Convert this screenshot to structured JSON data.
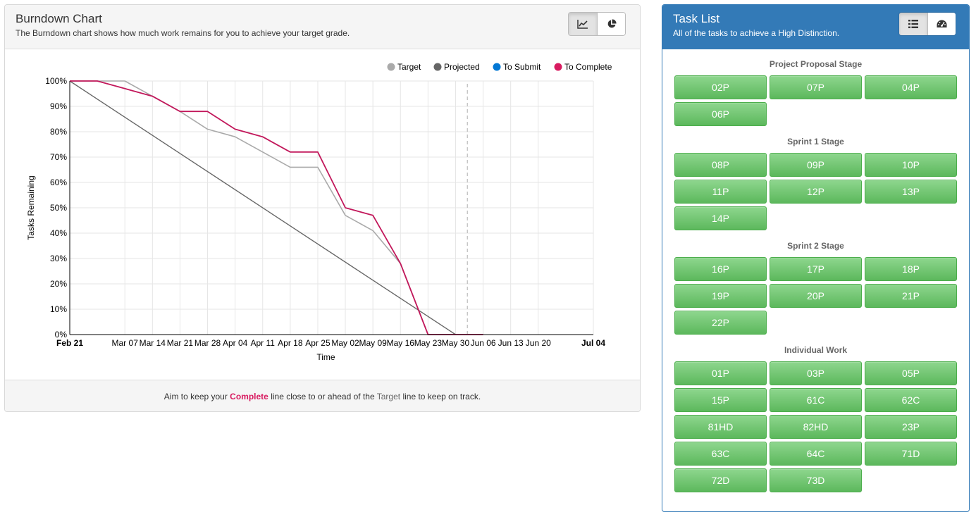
{
  "burndown": {
    "title": "Burndown Chart",
    "subtitle": "The Burndown chart shows how much work remains for you to achieve your target grade.",
    "view_buttons": [
      {
        "icon": "line-chart-icon",
        "active": true
      },
      {
        "icon": "pie-chart-icon",
        "active": false
      }
    ],
    "footer": {
      "prefix": "Aim to keep your ",
      "complete_word": "Complete",
      "middle": " line close to or ahead of the ",
      "target_word": "Target",
      "suffix": " line to keep on track."
    }
  },
  "chart_data": {
    "type": "line",
    "xlabel": "Time",
    "ylabel": "Tasks Remaining",
    "ylim": [
      0,
      100
    ],
    "y_ticks": [
      "0%",
      "10%",
      "20%",
      "30%",
      "40%",
      "50%",
      "60%",
      "70%",
      "80%",
      "90%",
      "100%"
    ],
    "x_ticks": [
      "Feb 21",
      "Mar 07",
      "Mar 14",
      "Mar 21",
      "Mar 28",
      "Apr 04",
      "Apr 11",
      "Apr 18",
      "Apr 25",
      "May 02",
      "May 09",
      "May 16",
      "May 23",
      "May 30",
      "Jun 06",
      "Jun 13",
      "Jun 20",
      "Jul 04"
    ],
    "x_bold_ticks": [
      "Feb 21",
      "Jul 04"
    ],
    "x_tick_days": [
      0,
      14,
      21,
      28,
      35,
      42,
      49,
      56,
      63,
      70,
      77,
      84,
      91,
      98,
      105,
      112,
      119,
      133
    ],
    "x_range_days": [
      0,
      133
    ],
    "marker_line_day": 101,
    "grid": true,
    "legend_position": "top-right",
    "colors": {
      "target": "#aaaaaa",
      "projected": "#666666",
      "to_submit": "#0277d4",
      "to_complete": "#c2185b"
    },
    "legend": [
      {
        "name": "Target",
        "color": "#aaaaaa"
      },
      {
        "name": "Projected",
        "color": "#666666"
      },
      {
        "name": "To Submit",
        "color": "#0277d4"
      },
      {
        "name": "To Complete",
        "color": "#d81b60"
      }
    ],
    "series": [
      {
        "name": "Target",
        "color": "#aaaaaa",
        "x": [
          0,
          14,
          21,
          28,
          35,
          42,
          49,
          56,
          63,
          70,
          77,
          84,
          91,
          98,
          105
        ],
        "values": [
          100,
          100,
          94,
          88,
          81,
          78,
          72,
          66,
          66,
          47,
          41,
          28,
          0,
          0,
          0
        ]
      },
      {
        "name": "Projected",
        "color": "#666666",
        "x": [
          0,
          98
        ],
        "values": [
          100,
          0
        ]
      },
      {
        "name": "To Complete",
        "color": "#c2185b",
        "x": [
          0,
          7,
          14,
          21,
          28,
          35,
          42,
          49,
          56,
          63,
          70,
          77,
          84,
          91,
          98,
          105
        ],
        "values": [
          100,
          100,
          97,
          94,
          88,
          88,
          81,
          78,
          72,
          72,
          50,
          47,
          28,
          0,
          0,
          0
        ]
      }
    ]
  },
  "tasklist": {
    "title": "Task List",
    "subtitle": "All of the tasks to achieve a High Distinction.",
    "view_buttons": [
      {
        "icon": "list-icon",
        "active": true
      },
      {
        "icon": "dashboard-icon",
        "active": false
      }
    ],
    "stages": [
      {
        "name": "Project Proposal Stage",
        "tasks": [
          "02P",
          "07P",
          "04P",
          "06P"
        ]
      },
      {
        "name": "Sprint 1 Stage",
        "tasks": [
          "08P",
          "09P",
          "10P",
          "11P",
          "12P",
          "13P",
          "14P"
        ]
      },
      {
        "name": "Sprint 2 Stage",
        "tasks": [
          "16P",
          "17P",
          "18P",
          "19P",
          "20P",
          "21P",
          "22P"
        ]
      },
      {
        "name": "Individual Work",
        "tasks": [
          "01P",
          "03P",
          "05P",
          "15P",
          "61C",
          "62C",
          "81HD",
          "82HD",
          "23P",
          "63C",
          "64C",
          "71D",
          "72D",
          "73D"
        ]
      }
    ]
  }
}
